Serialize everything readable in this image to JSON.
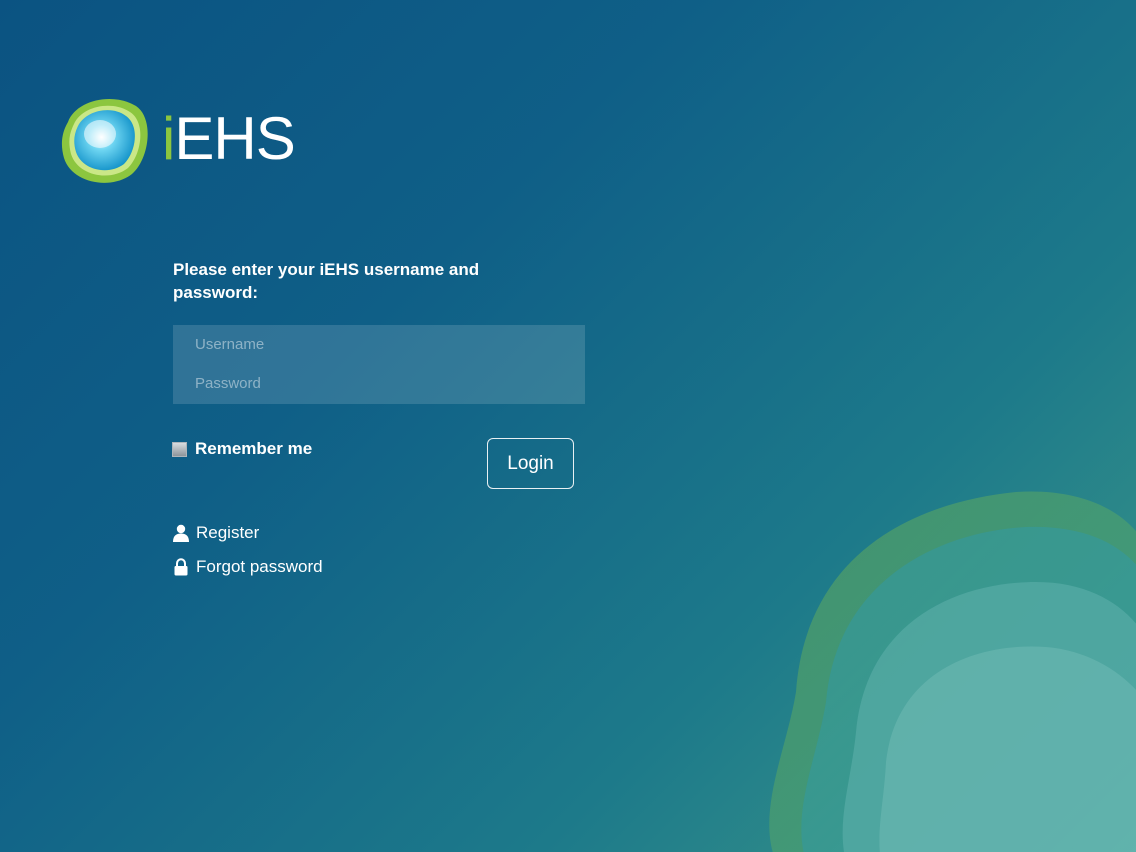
{
  "logo": {
    "prefix": "i",
    "suffix": "EHS"
  },
  "login_form": {
    "prompt": "Please enter your iEHS username and password:",
    "username_placeholder": "Username",
    "password_placeholder": "Password",
    "remember_label": "Remember me",
    "login_label": "Login"
  },
  "links": {
    "register": "Register",
    "forgot": "Forgot password"
  },
  "icons": {
    "logo": "iehs-logo-icon",
    "register": "user-icon",
    "forgot": "lock-icon"
  },
  "colors": {
    "brand_green": "#8cc63f",
    "brand_blue": "#0b5382",
    "accent_teal": "#3f9a88"
  }
}
